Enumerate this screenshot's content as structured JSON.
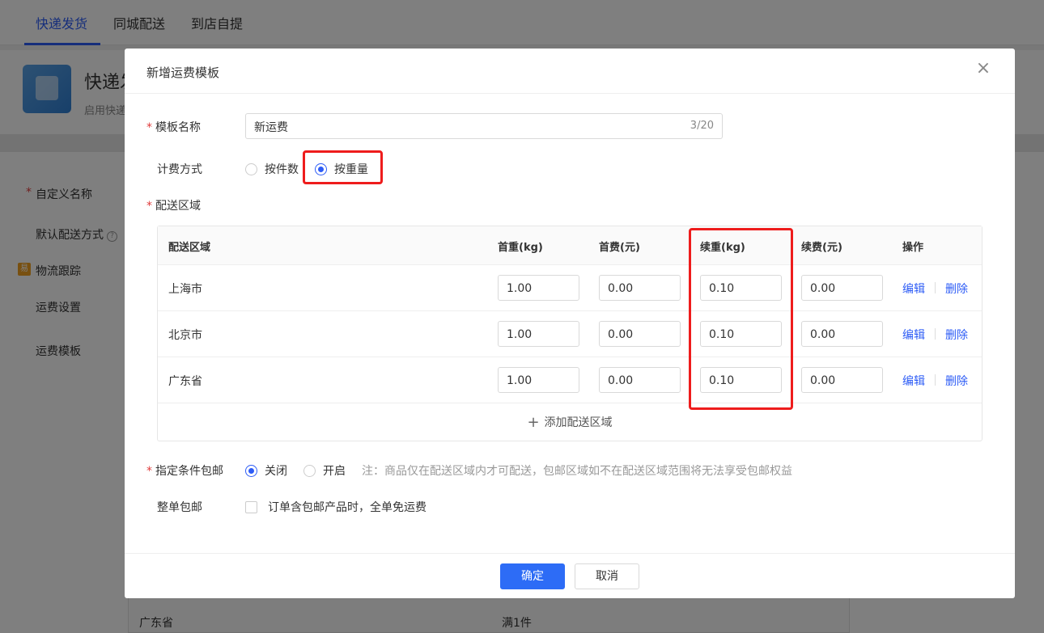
{
  "background": {
    "tabs": [
      "快递发货",
      "同城配送",
      "到店自提"
    ],
    "app_title": "快递发",
    "app_subtitle": "启用快递",
    "sidebar": {
      "custom_name": "自定义名称",
      "default_method": "默认配送方式",
      "logistics": "物流跟踪",
      "logistics_icon_text": "易",
      "freight_settings": "运费设置",
      "freight_template": "运费模板"
    },
    "bottom_row": {
      "region": "广东省",
      "condition": "满1件"
    }
  },
  "modal": {
    "title": "新增运费模板",
    "close_glyph": "×",
    "template_name": {
      "label": "模板名称",
      "value": "新运费",
      "count": "3/20"
    },
    "billing": {
      "label": "计费方式",
      "options": [
        "按件数",
        "按重量"
      ],
      "selected": "按重量"
    },
    "region": {
      "label": "配送区域",
      "headers": [
        "配送区域",
        "首重(kg)",
        "首费(元)",
        "续重(kg)",
        "续费(元)",
        "操作"
      ],
      "rows": [
        {
          "region": "上海市",
          "first_weight": "1.00",
          "first_fee": "0.00",
          "extra_weight": "0.10",
          "extra_fee": "0.00"
        },
        {
          "region": "北京市",
          "first_weight": "1.00",
          "first_fee": "0.00",
          "extra_weight": "0.10",
          "extra_fee": "0.00"
        },
        {
          "region": "广东省",
          "first_weight": "1.00",
          "first_fee": "0.00",
          "extra_weight": "0.10",
          "extra_fee": "0.00"
        }
      ],
      "edit_label": "编辑",
      "delete_label": "删除",
      "add_label": "添加配送区域",
      "add_glyph": "+"
    },
    "free_shipping": {
      "label": "指定条件包邮",
      "options": [
        "关闭",
        "开启"
      ],
      "selected": "关闭",
      "note": "注：商品仅在配送区域内才可配送，包邮区域如不在配送区域范围将无法享受包邮权益"
    },
    "order_free": {
      "label": "整单包邮",
      "checkbox_label": "订单含包邮产品时，全单免运费",
      "checked": false
    },
    "footer": {
      "confirm": "确定",
      "cancel": "取消"
    }
  },
  "highlight_color": "#ee1c1c",
  "accent_color": "#2d5cf6"
}
